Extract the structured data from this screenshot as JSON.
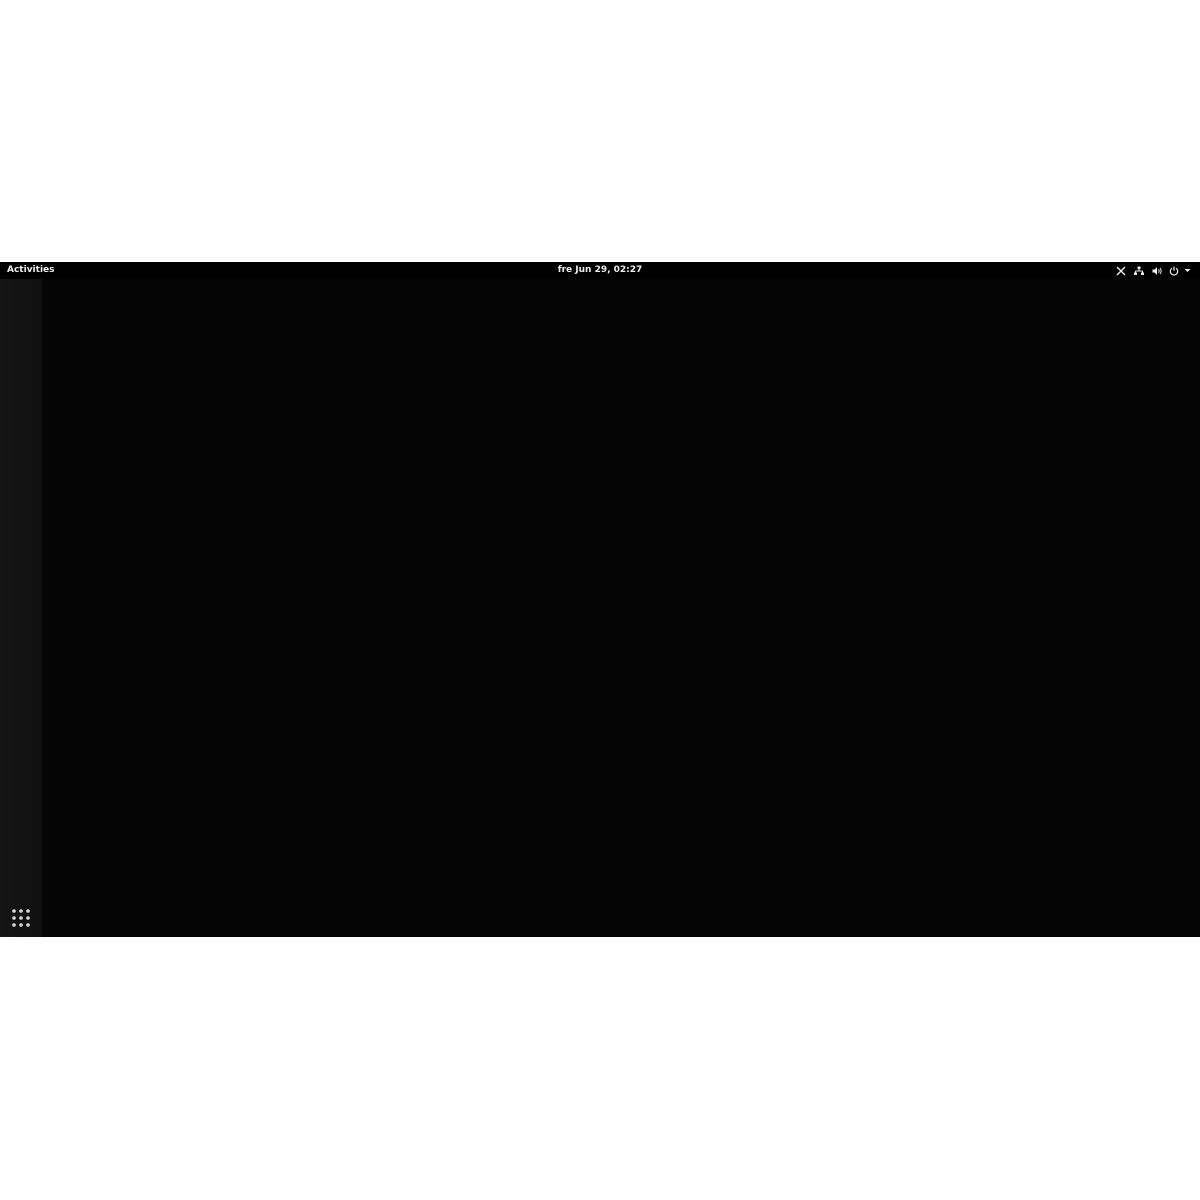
{
  "topbar": {
    "activities_label": "Activities",
    "clock": "fre Jun 29, 02:27"
  },
  "tray": {
    "icons": [
      "x-app-icon",
      "network-wired-icon",
      "volume-icon",
      "power-icon",
      "menu-arrow-icon"
    ]
  },
  "dash": {
    "show_apps_icon": "app-grid-icon"
  },
  "colors": {
    "panel_bg": "#000000",
    "panel_text": "#eeeeec",
    "dash_bg": "#151515",
    "desktop_bg": "#050505"
  }
}
